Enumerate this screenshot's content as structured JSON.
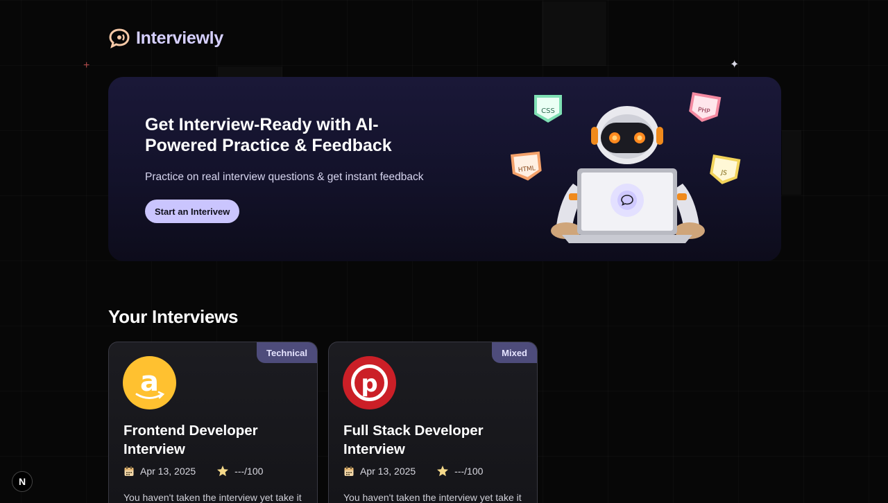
{
  "brand": {
    "name": "Interviewly"
  },
  "hero": {
    "title": "Get Interview-Ready with AI-Powered Practice & Feedback",
    "subtitle": "Practice on real interview questions & get instant feedback",
    "cta_label": "Start an Interivew",
    "tags": {
      "css": "CSS",
      "php": "PHP",
      "html": "HTML",
      "js": "JS"
    }
  },
  "section": {
    "title": "Your Interviews"
  },
  "interviews": [
    {
      "type": "Technical",
      "company_icon": "amazon-logo",
      "title": "Frontend Developer Interview",
      "date": "Apr 13, 2025",
      "score": "---/100",
      "description": "You haven't taken the interview yet take it"
    },
    {
      "type": "Mixed",
      "company_icon": "pinterest-logo",
      "title": "Full Stack Developer Interview",
      "date": "Apr 13, 2025",
      "score": "---/100",
      "description": "You haven't taken the interview yet take it"
    }
  ],
  "dev_badge": {
    "label": "N"
  },
  "colors": {
    "accent": "#cac5fe",
    "badge_bg": "#4e4c7b",
    "amazon": "#ffc130",
    "pinterest": "#cb1f27",
    "background": "#070707"
  }
}
